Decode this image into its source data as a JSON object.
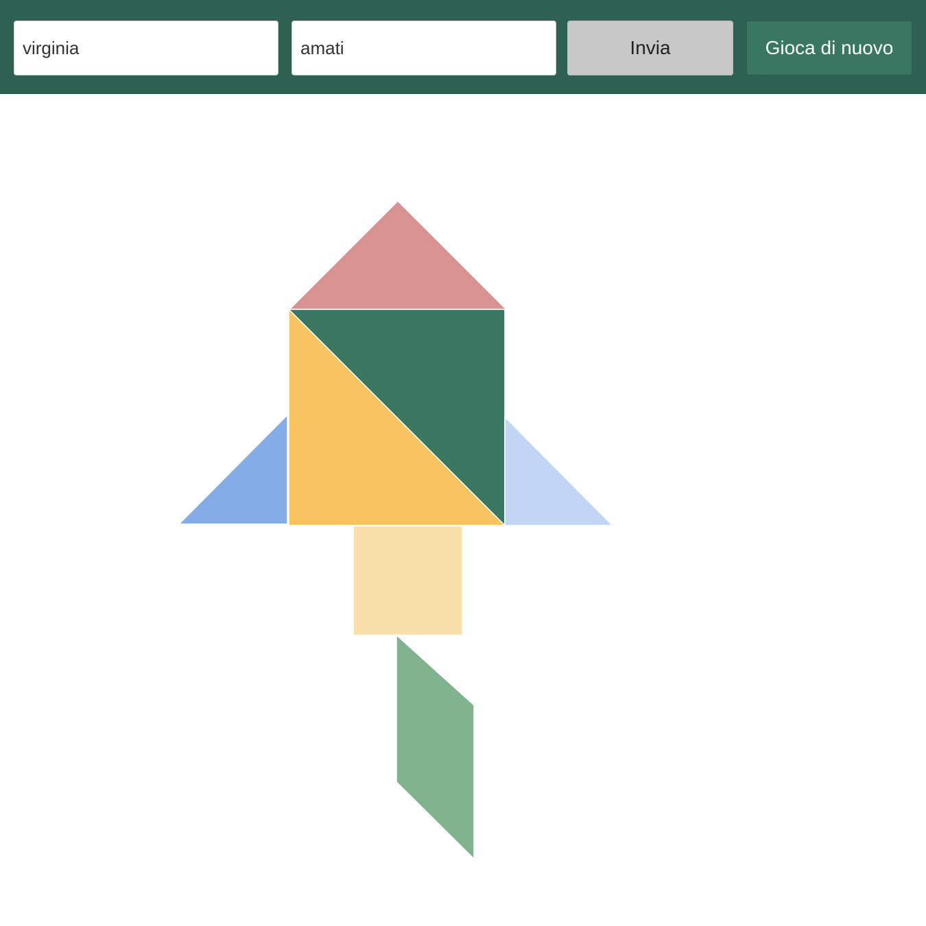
{
  "form": {
    "first_name_value": "virginia",
    "last_name_value": "amati",
    "submit_label": "Invia",
    "replay_label": "Gioca di nuovo"
  },
  "colors": {
    "header_bg": "#2e6151",
    "button_submit_bg": "#c8c8c8",
    "button_replay_bg": "#3a7762",
    "piece_top_triangle": "#d99393",
    "piece_large_dark_triangle": "#3a7762",
    "piece_large_yellow_triangle": "#f6c35f",
    "piece_left_blue_triangle": "#84ace7",
    "piece_right_light_blue_triangle": "#c2d5f5",
    "piece_square": "#f9e0aa",
    "piece_parallelogram": "#80b28e"
  }
}
